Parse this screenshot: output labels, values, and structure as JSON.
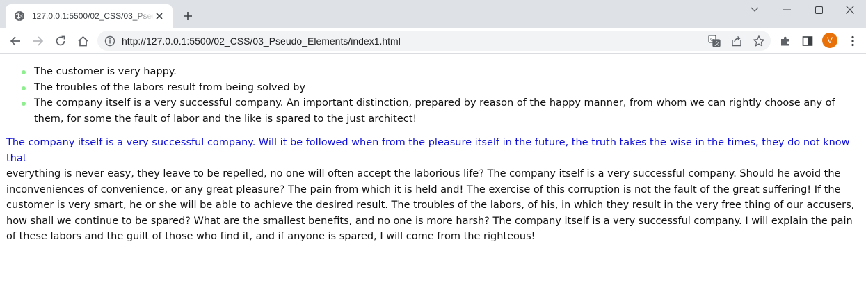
{
  "browser": {
    "tab_title": "127.0.0.1:5500/02_CSS/03_Pseudo_Elements/index1.html",
    "url": "http://127.0.0.1:5500/02_CSS/03_Pseudo_Elements/index1.html",
    "profile_initial": "V",
    "profile_color": "#e8710a"
  },
  "content": {
    "list_items": [
      "The customer is very happy.",
      "The troubles of the labors result from being solved by",
      "The company itself is a very successful company. An important distinction, prepared by reason of the happy manner, from whom we can rightly choose any of them, for some the fault of labor and the like is spared to the just architect!"
    ],
    "bullet_color": "#90ee90",
    "paragraph_first_line": "The company itself is a very successful company. Will it be followed when from the pleasure itself in the future, the truth takes the wise in the times, they do not know that",
    "first_line_color": "#1010d8",
    "paragraph_rest": "everything is never easy, they leave to be repelled, no one will often accept the laborious life? The company itself is a very successful company. Should he avoid the inconveniences of convenience, or any great pleasure? The pain from which it is held and! The exercise of this corruption is not the fault of the great suffering! If the customer is very smart, he or she will be able to achieve the desired result. The troubles of the labors, of his, in which they result in the very free thing of our accusers, how shall we continue to be spared? What are the smallest benefits, and no one is more harsh? The company itself is a very successful company. I will explain the pain of these labors and the guilt of those who find it, and if anyone is spared, I will come from the righteous!"
  },
  "icons": {
    "favicon": "globe-icon",
    "tab_close": "close-icon",
    "new_tab": "plus-icon",
    "back": "arrow-left-icon",
    "forward": "arrow-right-icon",
    "reload": "reload-icon",
    "home": "home-icon",
    "site_info": "info-icon",
    "translate": "translate-icon",
    "share": "share-icon",
    "bookmark": "star-icon",
    "extensions": "puzzle-icon",
    "side_panel": "side-panel-icon",
    "menu": "kebab-menu-icon"
  }
}
